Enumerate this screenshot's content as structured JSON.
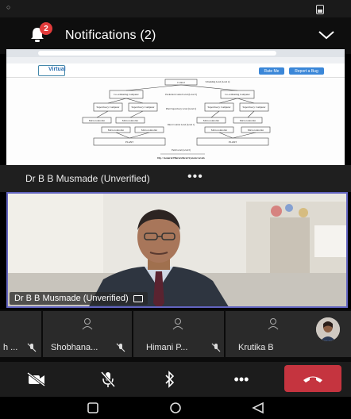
{
  "notifications": {
    "title": "Notifications (2)",
    "badge": "2"
  },
  "shared_screen": {
    "site_label": "Virtual",
    "btn_rate": "Rate Me",
    "btn_report": "Report a Bug",
    "diagram": {
      "top": "Control",
      "scheduling": "Scheduling Level (Level 4)",
      "coord1": "Co-ordinating Computer",
      "coord2": "Co-ordinating Computer",
      "prod": "Production Control Level (Level 3)",
      "super1": "Supervisory Computer",
      "super2": "Supervisory Computer",
      "super3": "Supervisory Computer",
      "super4": "Supervisory Computer",
      "plant_sup": "Plant Supervisory Level (Level 2)",
      "micro": "Microcontroller",
      "direct": "Direct Control Level (Level 1)",
      "plant": "PLANT",
      "field": "Field Level (Level 0)",
      "caption": "Fig.: General Hierarchical System Levels"
    }
  },
  "presenter_strip": {
    "name": "Dr B B Musmade (Unverified)",
    "more": "•••"
  },
  "main_video": {
    "label": "Dr B B Musmade (Unverified)"
  },
  "participants": [
    {
      "name": "h ..."
    },
    {
      "name": "Shobhana..."
    },
    {
      "name": "Himani P..."
    },
    {
      "name": "Krutika B"
    }
  ],
  "controls": {
    "more": "•••"
  },
  "colors": {
    "accent": "#6264c0",
    "end_call": "#c5343f",
    "badge": "#e23b3b"
  }
}
